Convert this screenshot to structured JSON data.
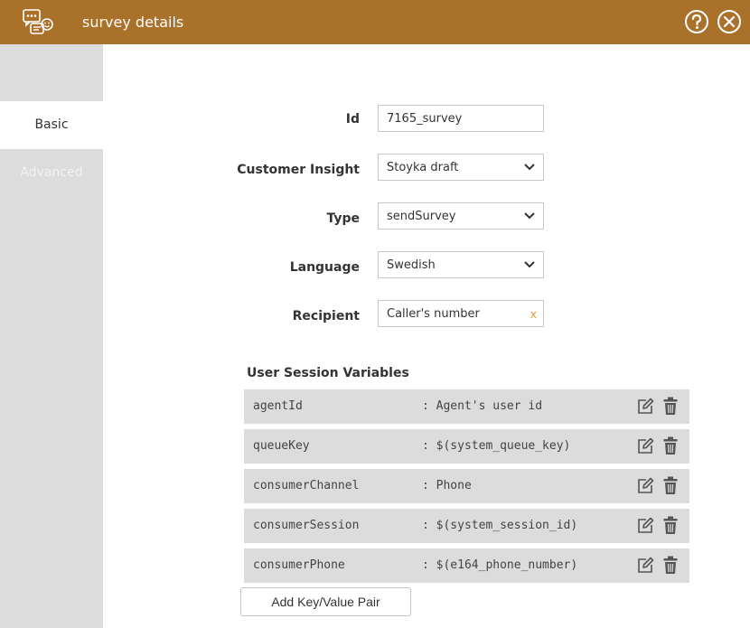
{
  "window": {
    "title": "survey details",
    "icon": "survey-chat-icon",
    "help_icon": "help-circle-icon",
    "close_icon": "close-circle-icon"
  },
  "sidebar": {
    "tabs": [
      {
        "label": "Basic",
        "state": "active"
      },
      {
        "label": "Advanced",
        "state": "disabled"
      }
    ]
  },
  "form": {
    "id": {
      "label": "Id",
      "value": "7165_survey"
    },
    "customer_insight": {
      "label": "Customer Insight",
      "value": "Stoyka draft"
    },
    "type": {
      "label": "Type",
      "value": "sendSurvey"
    },
    "language": {
      "label": "Language",
      "value": "Swedish"
    },
    "recipient": {
      "label": "Recipient",
      "value": "Caller's number",
      "clear_glyph": "x"
    }
  },
  "session_variables": {
    "title": "User Session Variables",
    "separator": ":",
    "rows": [
      {
        "key": "agentId",
        "value": "Agent's user id"
      },
      {
        "key": "queueKey",
        "value": "$(system_queue_key)"
      },
      {
        "key": "consumerChannel",
        "value": "Phone"
      },
      {
        "key": "consumerSession",
        "value": "$(system_session_id)"
      },
      {
        "key": "consumerPhone",
        "value": "$(e164_phone_number)"
      }
    ],
    "add_button_label": "Add Key/Value Pair"
  },
  "colors": {
    "titlebar": "#a9712a",
    "sidebar": "#dcdcdc",
    "row": "#dcdcdc",
    "clear_accent": "#e5962c"
  }
}
